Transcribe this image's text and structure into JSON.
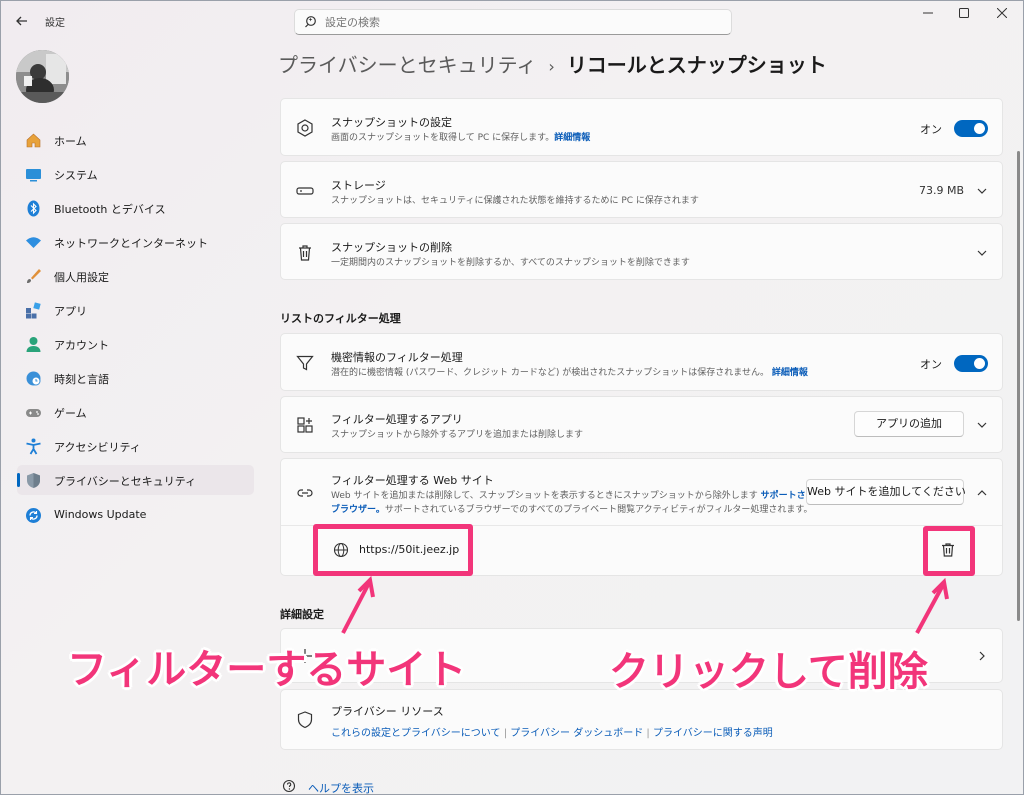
{
  "app": {
    "title": "設定"
  },
  "search": {
    "placeholder": "設定の検索"
  },
  "sidebar": {
    "items": [
      {
        "label": "ホーム"
      },
      {
        "label": "システム"
      },
      {
        "label": "Bluetooth とデバイス"
      },
      {
        "label": "ネットワークとインターネット"
      },
      {
        "label": "個人用設定"
      },
      {
        "label": "アプリ"
      },
      {
        "label": "アカウント"
      },
      {
        "label": "時刻と言語"
      },
      {
        "label": "ゲーム"
      },
      {
        "label": "アクセシビリティ"
      },
      {
        "label": "プライバシーとセキュリティ"
      },
      {
        "label": "Windows Update"
      }
    ],
    "selected_index": 10
  },
  "breadcrumb": {
    "parent": "プライバシーとセキュリティ",
    "separator": "›",
    "current": "リコールとスナップショット"
  },
  "cards": {
    "snapshot_settings": {
      "title": "スナップショットの設定",
      "desc": "画面のスナップショットを取得して PC に保存します。",
      "link": "詳細情報",
      "toggle_label": "オン",
      "toggle_on": true
    },
    "storage": {
      "title": "ストレージ",
      "desc": "スナップショットは、セキュリティに保護された状態を維持するために PC に保存されます",
      "value": "73.9 MB"
    },
    "delete_snapshots": {
      "title": "スナップショットの削除",
      "desc": "一定期間内のスナップショットを削除するか、すべてのスナップショットを削除できます"
    },
    "sensitive_filter": {
      "title": "機密情報のフィルター処理",
      "desc": "潜在的に機密情報 (パスワード、クレジット カードなど) が検出されたスナップショットは保存されません。",
      "link": "詳細情報",
      "toggle_label": "オン",
      "toggle_on": true
    },
    "filter_apps": {
      "title": "フィルター処理するアプリ",
      "desc": "スナップショットから除外するアプリを追加または削除します",
      "button": "アプリの追加"
    },
    "filter_websites": {
      "title": "フィルター処理する Web サイト",
      "desc_line1": "Web サイトを追加または削除して、スナップショットを表示するときにスナップショットから除外します",
      "link_part1": "サポートされている",
      "link_part2": "ブラウザー。",
      "desc_line2": "サポートされているブラウザーでのすべてのプライベート閲覧アクティビティがフィルター処理されます。",
      "button": "Web サイトを追加してください",
      "site_url": "https://50it.jeez.jp"
    },
    "privacy_resources": {
      "title": "プライバシー リソース",
      "links": [
        "これらの設定とプライバシーについて",
        "プライバシー ダッシュボード",
        "プライバシーに関する声明"
      ],
      "link_sep": "|"
    }
  },
  "sections": {
    "filter_list": "リストのフィルター処理",
    "advanced": "詳細設定"
  },
  "help": {
    "label": "ヘルプを表示"
  },
  "annotations": {
    "callout_site": "フィルターするサイト",
    "callout_delete": "クリックして削除",
    "accent_color": "#f2357a"
  },
  "colors": {
    "accent": "#0067c0",
    "link": "#0a5cb8"
  }
}
